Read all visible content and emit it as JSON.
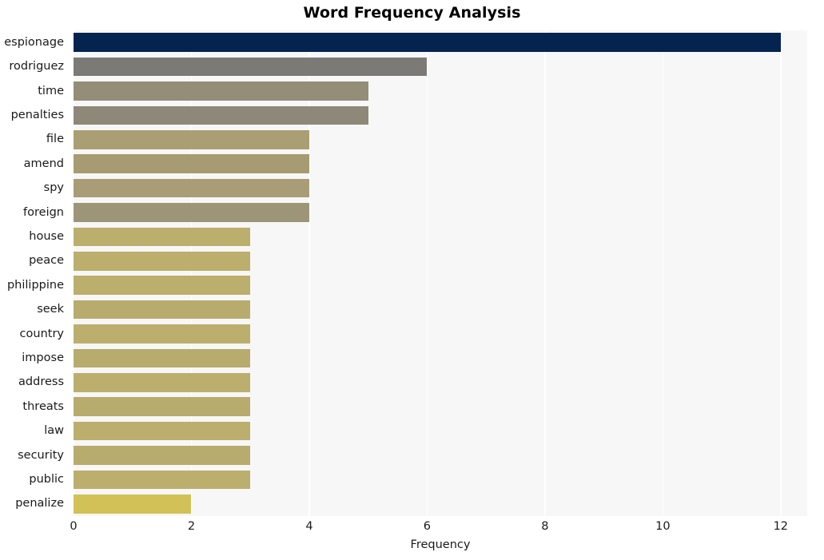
{
  "chart_data": {
    "type": "bar",
    "orientation": "horizontal",
    "title": "Word Frequency Analysis",
    "xlabel": "Frequency",
    "ylabel": "",
    "xlim": [
      0,
      12.45
    ],
    "xticks": [
      0,
      2,
      4,
      6,
      8,
      10,
      12
    ],
    "xtick_labels": [
      "0",
      "2",
      "4",
      "6",
      "8",
      "10",
      "12"
    ],
    "grid": {
      "vertical": true,
      "horizontal": false,
      "color": "#ffffff"
    },
    "legend": null,
    "categories": [
      "espionage",
      "rodriguez",
      "time",
      "penalties",
      "file",
      "amend",
      "spy",
      "foreign",
      "house",
      "peace",
      "philippine",
      "seek",
      "country",
      "impose",
      "address",
      "threats",
      "law",
      "security",
      "public",
      "penalize"
    ],
    "values": [
      12,
      6,
      5,
      5,
      4,
      4,
      4,
      4,
      3,
      3,
      3,
      3,
      3,
      3,
      3,
      3,
      3,
      3,
      3,
      2
    ],
    "bar_colors": [
      "#04244f",
      "#7b7a76",
      "#948d77",
      "#8e8879",
      "#aa9f74",
      "#a69b72",
      "#a89d77",
      "#9d9578",
      "#bcae6c",
      "#bcae6c",
      "#bcae6c",
      "#b8ab6e",
      "#bcae6c",
      "#b8ab6e",
      "#bcae6c",
      "#b8ab6e",
      "#bcae6c",
      "#b8ab6e",
      "#bcae6c",
      "#d2c157"
    ],
    "plot_background": "#f7f7f7",
    "figure_background": "#ffffff"
  }
}
